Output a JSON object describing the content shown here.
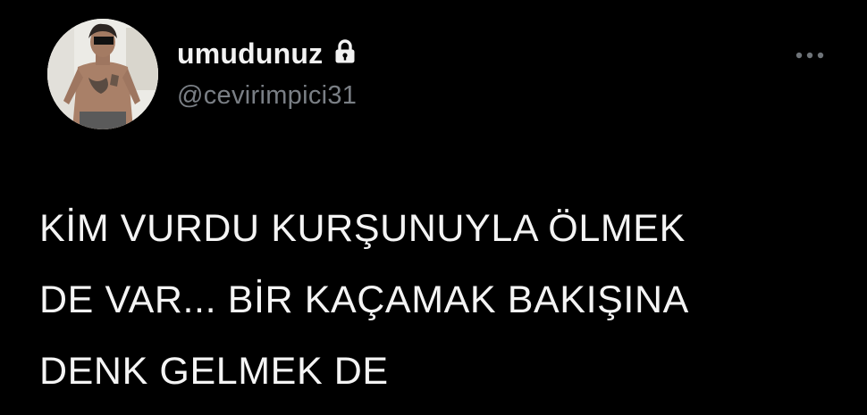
{
  "profile": {
    "display_name": "umudunuz",
    "handle": "@cevirimpici31",
    "protected_icon": "lock-icon",
    "avatar": "profile-photo"
  },
  "actions": {
    "more_icon": "more-horizontal-icon"
  },
  "tweet": {
    "lines": [
      "KİM VURDU KURŞUNUYLA ÖLMEK",
      "DE VAR... BİR KAÇAMAK BAKIŞINA",
      "DENK GELMEK DE"
    ]
  },
  "colors": {
    "background": "#000000",
    "name": "#f2f2f2",
    "handle": "#7a7f85",
    "text": "#f4f4f4",
    "more_icon": "#6e7378"
  }
}
